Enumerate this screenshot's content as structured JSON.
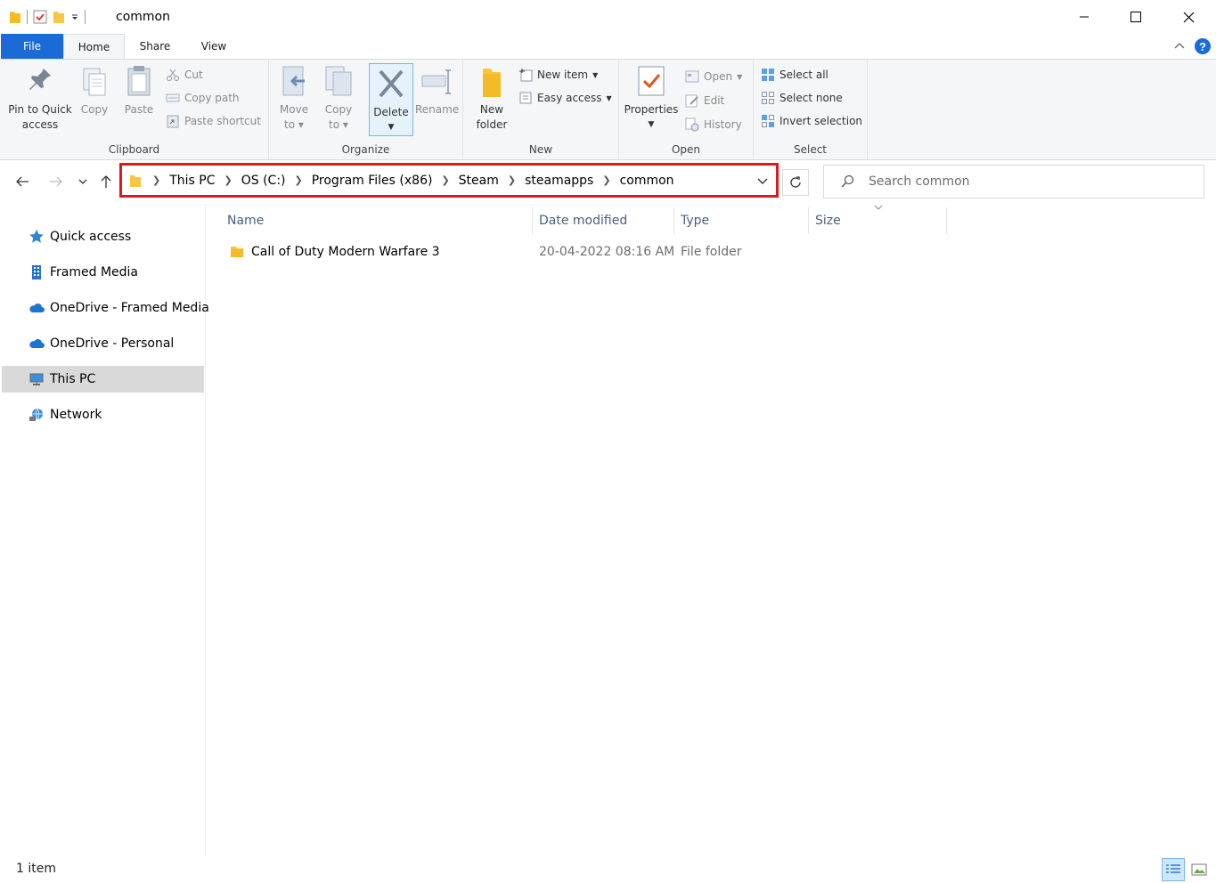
{
  "window": {
    "title": "common",
    "controls": [
      "minimize",
      "maximize",
      "close"
    ]
  },
  "ribbon_tabs": [
    "File",
    "Home",
    "Share",
    "View"
  ],
  "ribbon": {
    "clipboard": {
      "label": "Clipboard",
      "pin_line1": "Pin to Quick",
      "pin_line2": "access",
      "copy": "Copy",
      "paste": "Paste",
      "cut": "Cut",
      "copy_path": "Copy path",
      "paste_shortcut": "Paste shortcut"
    },
    "organize": {
      "label": "Organize",
      "move_line1": "Move",
      "move_line2": "to",
      "copyto_line1": "Copy",
      "copyto_line2": "to",
      "delete": "Delete",
      "rename": "Rename"
    },
    "new": {
      "label": "New",
      "folder_line1": "New",
      "folder_line2": "folder",
      "new_item": "New item",
      "easy_access": "Easy access"
    },
    "open": {
      "label": "Open",
      "properties": "Properties",
      "open": "Open",
      "edit": "Edit",
      "history": "History"
    },
    "select": {
      "label": "Select",
      "select_all": "Select all",
      "select_none": "Select none",
      "invert": "Invert selection"
    }
  },
  "address": {
    "breadcrumbs": [
      "This PC",
      "OS (C:)",
      "Program Files (x86)",
      "Steam",
      "steamapps",
      "common"
    ],
    "search_placeholder": "Search common"
  },
  "nav_pane": {
    "items": [
      {
        "label": "Quick access",
        "icon": "star-icon"
      },
      {
        "label": "Framed Media",
        "icon": "building-icon"
      },
      {
        "label": "OneDrive - Framed Media",
        "icon": "cloud-icon"
      },
      {
        "label": "OneDrive - Personal",
        "icon": "cloud-icon"
      },
      {
        "label": "This PC",
        "icon": "computer-icon",
        "selected": true
      },
      {
        "label": "Network",
        "icon": "network-icon"
      }
    ]
  },
  "file_list": {
    "columns": [
      "Name",
      "Date modified",
      "Type",
      "Size"
    ],
    "rows": [
      {
        "name": "Call of Duty Modern Warfare 3",
        "date": "20-04-2022 08:16 AM",
        "type": "File folder",
        "size": ""
      }
    ]
  },
  "status_bar": {
    "count": "1 item"
  },
  "colors": {
    "accent": "#1a6bd6",
    "highlight_border": "#e0171e",
    "selected_nav": "#d9d9d9",
    "folder": "#f8c640"
  }
}
